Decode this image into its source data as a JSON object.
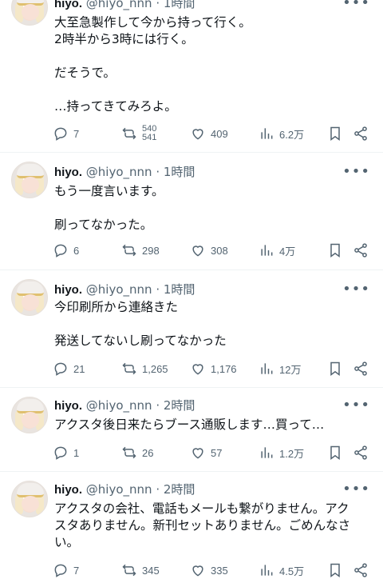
{
  "user": {
    "name": "hiyo.",
    "handle": "@hiyo_nnn",
    "separator": "·"
  },
  "tweets": [
    {
      "time": "1時間",
      "lines": [
        "大至急製作して今から持って行く。",
        "2時半から3時には行く。",
        "",
        "だそうで。",
        "",
        "…持ってきてみろよ。"
      ],
      "replies": "7",
      "retweets": "540",
      "retweets_b": "541",
      "likes": "409",
      "views": "6.2万"
    },
    {
      "time": "1時間",
      "lines": [
        "もう一度言います。",
        "",
        "刷ってなかった。"
      ],
      "replies": "6",
      "retweets": "298",
      "likes": "308",
      "views": "4万"
    },
    {
      "time": "1時間",
      "lines": [
        "今印刷所から連絡きた",
        "",
        "発送してないし刷ってなかった"
      ],
      "replies": "21",
      "retweets": "1,265",
      "likes": "1,176",
      "views": "12万"
    },
    {
      "time": "2時間",
      "lines": [
        "アクスタ後日来たらブース通販します…買って…"
      ],
      "replies": "1",
      "retweets": "26",
      "likes": "57",
      "views": "1.2万"
    },
    {
      "time": "2時間",
      "lines": [
        "アクスタの会社、電話もメールも繋がりません。アク",
        "スタありません。新刊セットありません。ごめんなさ",
        "い。"
      ],
      "replies": "7",
      "retweets": "345",
      "likes": "335",
      "views": "4.5万"
    }
  ],
  "icons": {
    "reply": "reply-icon",
    "retweet": "retweet-icon",
    "like": "heart-icon",
    "views": "views-icon",
    "bookmark": "bookmark-icon",
    "share": "share-icon",
    "more": "more-icon"
  }
}
